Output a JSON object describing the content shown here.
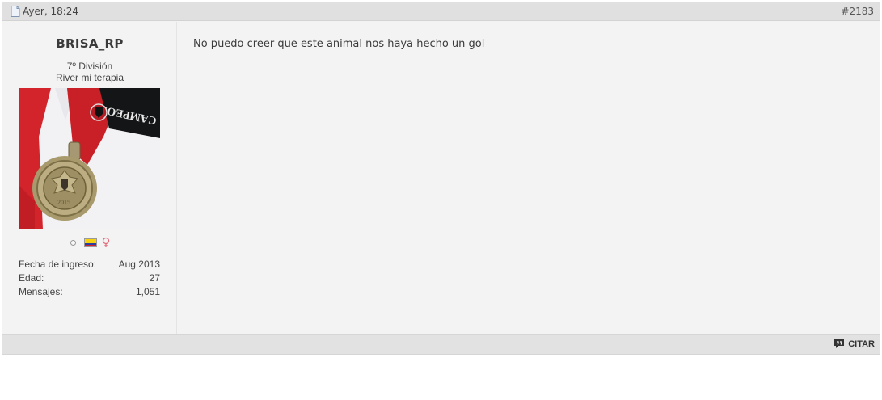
{
  "post": {
    "date": "Ayer, 18:24",
    "number": "#2183",
    "message": "No puedo creer que este animal nos haya hecho un gol"
  },
  "user": {
    "name": "BRISA_RP",
    "rank": "7º División",
    "title": "River mi terapia",
    "stats": [
      {
        "label": "Fecha de ingreso:",
        "value": "Aug 2013"
      },
      {
        "label": "Edad:",
        "value": "27"
      },
      {
        "label": "Mensajes:",
        "value": "1,051"
      }
    ]
  },
  "footer": {
    "quote_label": "CITAR"
  },
  "icons": {
    "date": "document-icon",
    "online": "offline-status-icon",
    "flag": "colombia-flag-icon",
    "gender": "female-gender-icon",
    "quote": "quote-bubble-icon"
  },
  "avatar": {
    "text": "CAMPEON"
  }
}
